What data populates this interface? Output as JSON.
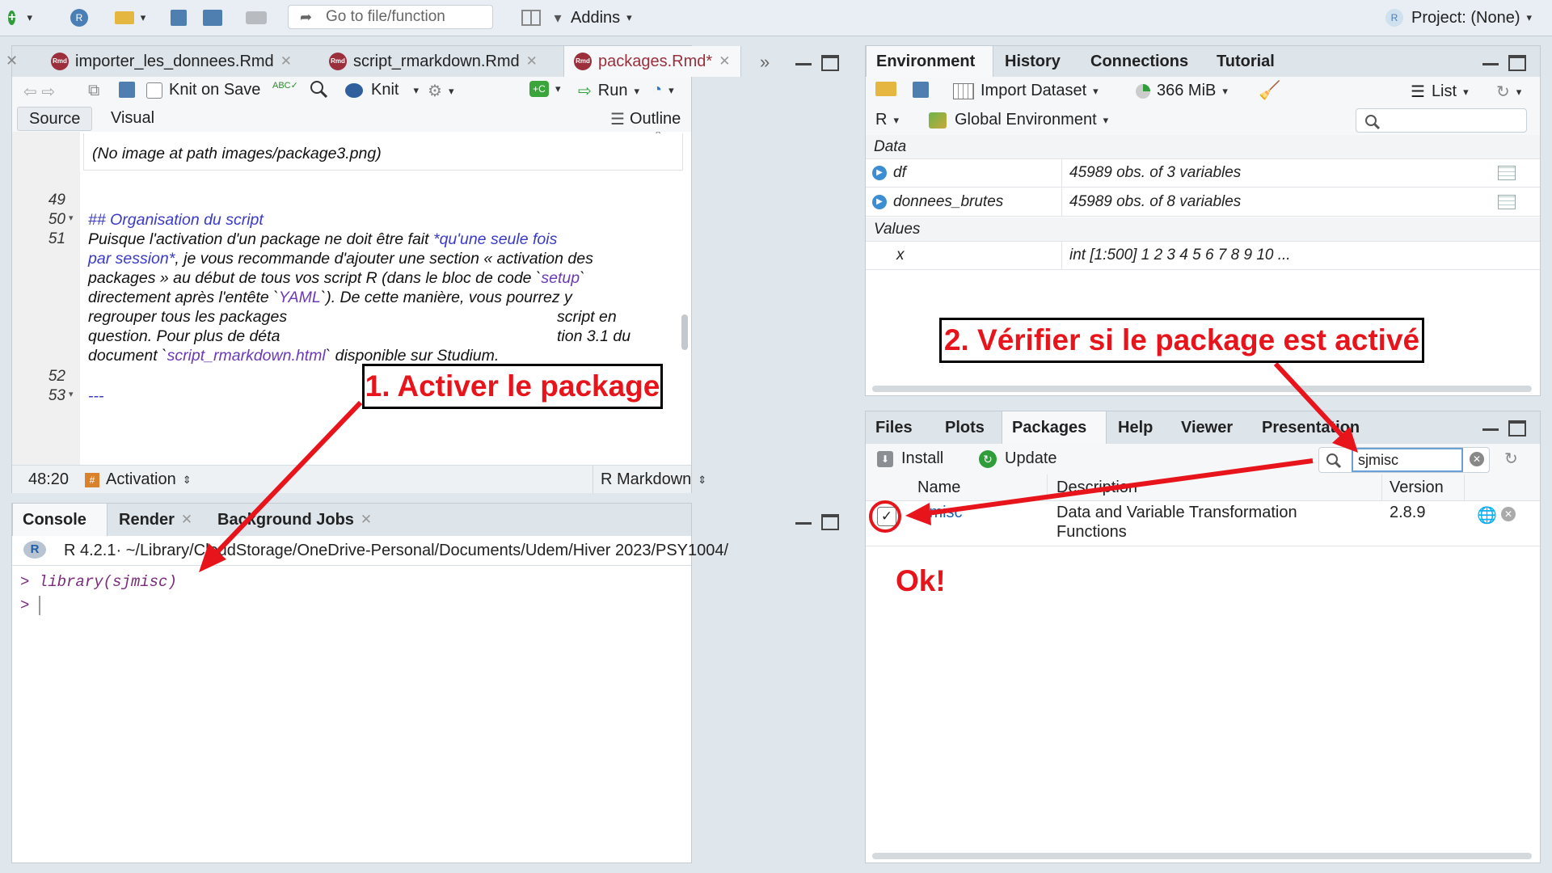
{
  "topbar": {
    "goto_placeholder": "Go to file/function",
    "addins": "Addins",
    "project": "Project: (None)"
  },
  "editor": {
    "tabs": [
      "importer_les_donnees.Rmd",
      "script_rmarkdown.Rmd",
      "packages.Rmd*"
    ],
    "toolbar": {
      "knit_on_save": "Knit on Save",
      "knit": "Knit",
      "run": "Run"
    },
    "modes": {
      "source": "Source",
      "visual": "Visual",
      "outline": "Outline"
    },
    "no_image": "(No image at path images/package3.png)",
    "line_numbers": [
      "49",
      "50",
      "51",
      "52",
      "53"
    ],
    "lines": {
      "l50": "## Organisation du script",
      "l51a": "Puisque l'activation d'un package ne doit être fait ",
      "l51a_em": "*qu'une seule fois",
      "l51b_em": "par session*",
      "l51b": ", je vous recommande d'ajouter une section « activation des",
      "l51c": "packages » au début de tous vos script R (dans le bloc de code `",
      "l51c_code": "setup",
      "l51c_end": "`",
      "l51d": "directement après l'entête `",
      "l51d_code": "YAML",
      "l51d_end": "`). De cette manière, vous pourrez y",
      "l51e": "regrouper tous les packages",
      "l51e_end": "script en",
      "l51f": "question. Pour plus de déta",
      "l51f_end": "tion 3.1 du",
      "l51g": "document `",
      "l51g_code": "script_rmarkdown.html",
      "l51g_end": "` disponible sur Studium.",
      "l53": "---"
    },
    "status": {
      "position": "48:20",
      "section": "Activation",
      "filetype": "R Markdown"
    }
  },
  "console": {
    "tabs": [
      "Console",
      "Render",
      "Background Jobs"
    ],
    "r_version": "R 4.2.1",
    "path": " · ~/Library/CloudStorage/OneDrive-Personal/Documents/Udem/Hiver 2023/PSY1004/",
    "prompt": ">",
    "command": "library(sjmisc)"
  },
  "environment": {
    "tabs": [
      "Environment",
      "History",
      "Connections",
      "Tutorial"
    ],
    "toolbar": {
      "import": "Import Dataset",
      "memory": "366 MiB",
      "list": "List",
      "lang": "R",
      "scope": "Global Environment"
    },
    "sections": {
      "data": "Data",
      "values": "Values"
    },
    "data_rows": [
      {
        "name": "df",
        "value": "45989 obs. of 3 variables"
      },
      {
        "name": "donnees_brutes",
        "value": "45989 obs. of 8 variables"
      }
    ],
    "value_rows": [
      {
        "name": "x",
        "value": "int [1:500] 1 2 3 4 5 6 7 8 9 10 ..."
      }
    ]
  },
  "files": {
    "tabs": [
      "Files",
      "Plots",
      "Packages",
      "Help",
      "Viewer",
      "Presentation"
    ],
    "toolbar": {
      "install": "Install",
      "update": "Update",
      "search_value": "sjmisc"
    },
    "columns": {
      "name": "Name",
      "description": "Description",
      "version": "Version"
    },
    "packages": [
      {
        "name": "sjmisc",
        "description_1": "Data and Variable Transformation",
        "description_2": "Functions",
        "version": "2.8.9",
        "checked": "✓"
      }
    ]
  },
  "annotations": {
    "step1": "1. Activer le package",
    "step2": "2. Vérifier si le package est activé",
    "ok": "Ok!",
    "color": "#e8141b"
  }
}
